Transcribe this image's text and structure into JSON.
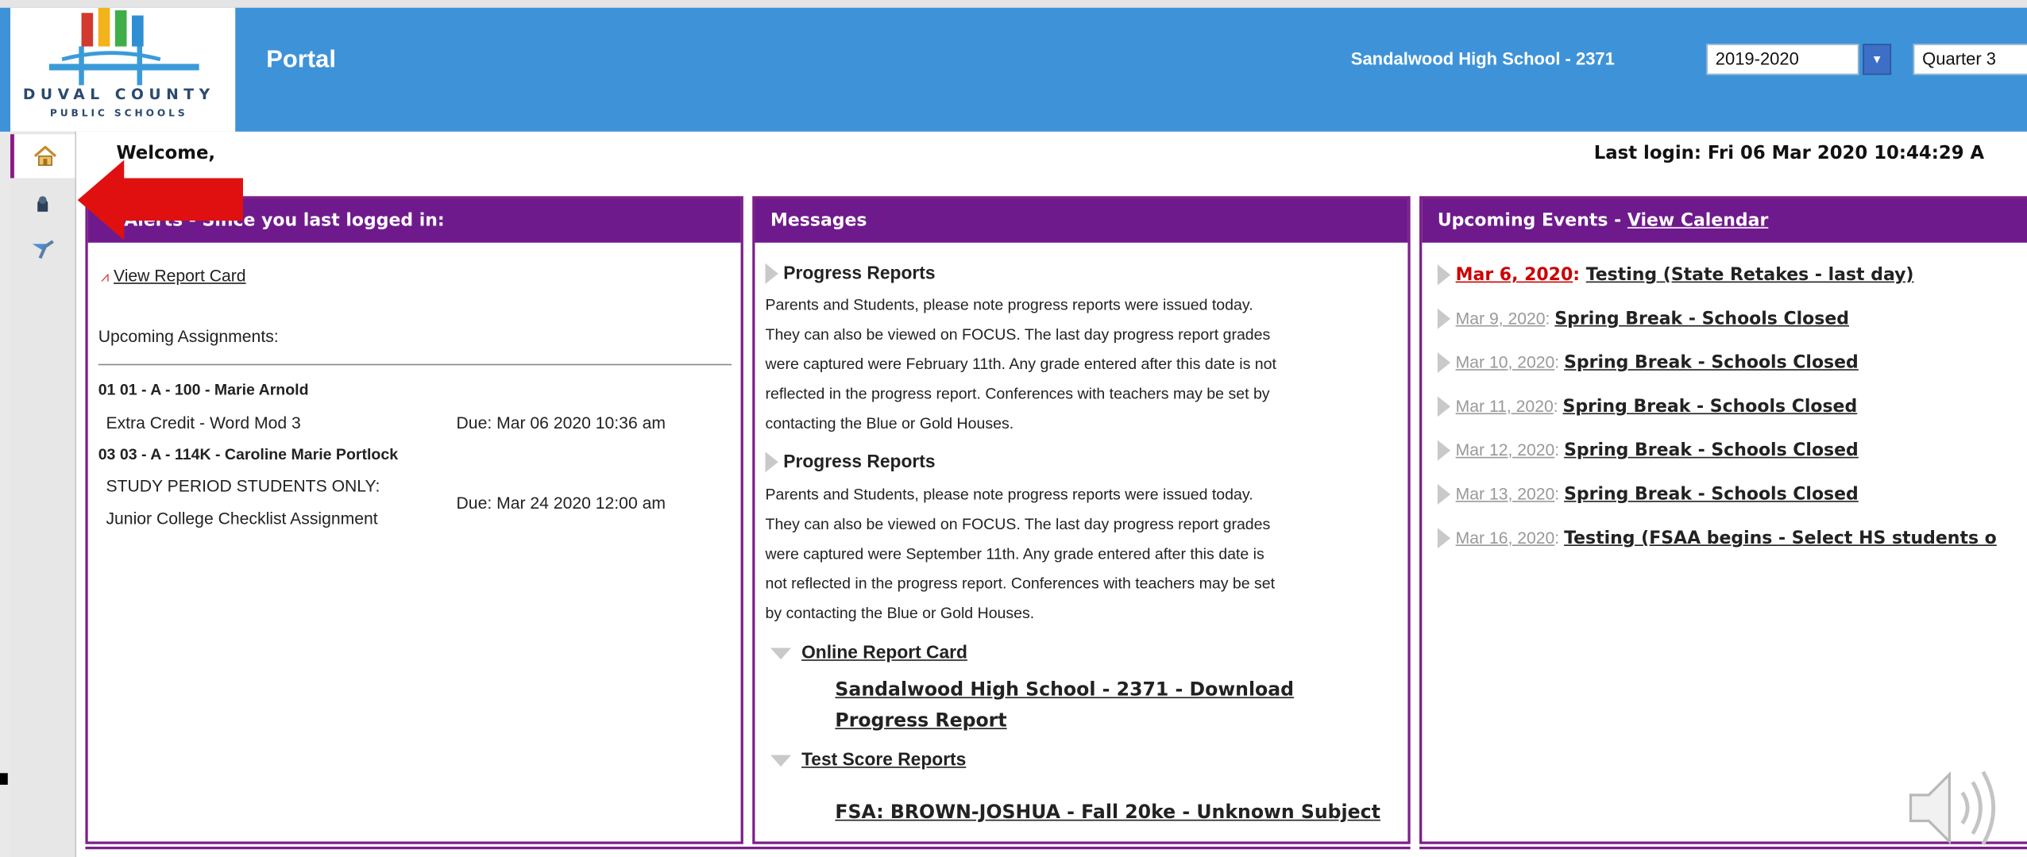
{
  "header": {
    "logo_line1": "DUVAL COUNTY",
    "logo_line2": "PUBLIC SCHOOLS",
    "title": "Portal",
    "school": "Sandalwood High School - 2371",
    "year": "2019-2020",
    "quarter": "Quarter 3"
  },
  "sidebar": {
    "items": [
      {
        "icon": "home-icon"
      },
      {
        "icon": "student-icon"
      },
      {
        "icon": "teacher-icon"
      }
    ]
  },
  "welcome": "Welcome,",
  "last_login": "Last login: Fri 06 Mar 2020 10:44:29 A",
  "alerts": {
    "title": "Alerts - Since you last logged in:",
    "report_card_link": "View Report Card",
    "upcoming_label": "Upcoming Assignments:",
    "assignments": [
      {
        "course": "01 01 - A - 100 - Marie Arnold",
        "name": "Extra Credit - Word Mod 3",
        "due": "Due: Mar 06 2020 10:36 am"
      },
      {
        "course": "03 03 - A - 114K - Caroline Marie Portlock",
        "name_line1": "STUDY PERIOD STUDENTS ONLY:",
        "name_line2": "Junior College Checklist Assignment",
        "due": "Due: Mar 24 2020 12:00 am"
      }
    ]
  },
  "messages": {
    "title": "Messages",
    "items": [
      {
        "heading": "Progress Reports",
        "lines": [
          "Parents and Students, please note progress reports were issued today.",
          "They can also be viewed on FOCUS. The last day progress report grades",
          "were captured were February 11th. Any grade entered after this date is not",
          "reflected in the progress report. Conferences with teachers may be set by",
          "contacting the Blue or Gold Houses."
        ]
      },
      {
        "heading": "Progress Reports",
        "lines": [
          "Parents and Students, please note progress reports were issued today.",
          "They can also be viewed on FOCUS. The last day progress report grades",
          "were captured were September 11th. Any grade entered after this date is",
          "not reflected in the progress report. Conferences with teachers may be set",
          "by contacting the Blue or Gold Houses."
        ]
      }
    ],
    "online_report_card": "Online Report Card",
    "download_line1": "Sandalwood High School - 2371 - Download",
    "download_line2": "Progress Report",
    "test_score_reports": "Test Score Reports",
    "fsa_line": "FSA: BROWN-JOSHUA - Fall 20ke - Unknown Subject"
  },
  "events": {
    "title": "Upcoming Events - ",
    "calendar_link": "View Calendar",
    "items": [
      {
        "date": "Mar 6, 2020",
        "sep": ": ",
        "name": "Testing (State Retakes - last day)"
      },
      {
        "date": "Mar 9, 2020",
        "sep": ": ",
        "name": "Spring Break - Schools Closed"
      },
      {
        "date": "Mar 10, 2020",
        "sep": ": ",
        "name": "Spring Break - Schools Closed"
      },
      {
        "date": "Mar 11, 2020",
        "sep": ": ",
        "name": "Spring Break - Schools Closed"
      },
      {
        "date": "Mar 12, 2020",
        "sep": ": ",
        "name": "Spring Break - Schools Closed"
      },
      {
        "date": "Mar 13, 2020",
        "sep": ": ",
        "name": "Spring Break - Schools Closed"
      },
      {
        "date": "Mar 16, 2020",
        "sep": ": ",
        "name": "Testing (FSAA begins - Select HS students o"
      }
    ]
  },
  "colors": {
    "header_blue": "#3e93d8",
    "panel_purple": "#6f1a8c",
    "arrow_red": "#e01010"
  },
  "overlays": {
    "pointer": "red-arrow-icon",
    "audio": "speaker-icon"
  }
}
